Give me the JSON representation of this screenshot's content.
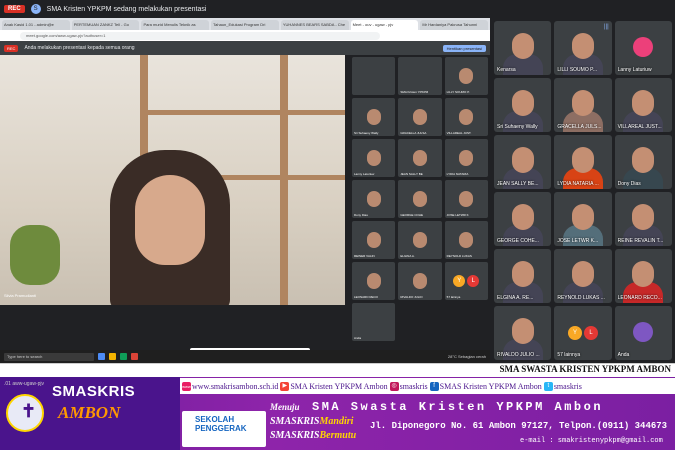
{
  "topbar": {
    "rec": "REC",
    "presenter_initial": "S",
    "status": "SMA Kristen YPKPM sedang melakukan presentasi"
  },
  "browser": {
    "tabs": [
      "Anak Kasid 1.01 - admin@e",
      "PERTEMUAN ZANKZ Tell - Go",
      "Para murid Menulis Teknik as",
      "Tahaun_Edukasi Program Dri",
      "YUHANNES BEARS SABDA - Che",
      "Meet - ouv - ugaw - pjv",
      "Mr Hardaniya Pakrusa Tahunni"
    ],
    "address": "meet.google.com/aww-ugaw-pjv?authuser=1",
    "meet_rec": "REC",
    "presenting_note": "Anda melakukan presentasi kepada semua orang",
    "stop_presenting": "Hentikan presentasi",
    "speaker_name": "Silvia Pramudianti",
    "share_note": "Meeting/google.co sedang dipresentasikan",
    "share_note_btn": "Stop sharing",
    "share_note_hide": "Hide",
    "meeting_code": "aww-ugaw-pjv",
    "taskbar_search": "Type here to search",
    "taskbar_time": "28°C  Sebagian cerah"
  },
  "mini_tiles": [
    "",
    "SMA Kristen YPKPM",
    "LILLY SOUMO P.",
    "Sri Suhaeny Wally",
    "GRACELLA JULSA",
    "VILLAREAL JUST.",
    "Lanny Laturiuw",
    "JEAN SALLY BE",
    "LYDIA NATARIA",
    "Dony Dias",
    "GEORGE COHE",
    "JOSE LETWR K",
    "REINER VALIN",
    "ELGINA A.",
    "REYNOLD LUKAS",
    "LEONARD RECO",
    "RIVALDO JULIO",
    "57 lainnya",
    "Anda"
  ],
  "mini_more": {
    "y": "Y",
    "l": "L"
  },
  "grid": [
    {
      "name": "Kenarsa",
      "type": "video"
    },
    {
      "name": "LILLI SOUMO P...",
      "type": "video",
      "mic": "|||"
    },
    {
      "name": "Lanny Laturiuw",
      "type": "avatar"
    },
    {
      "name": "Sri Suhaeny Wally",
      "type": "video"
    },
    {
      "name": "GRACELLA JULS...",
      "type": "video"
    },
    {
      "name": "VILLAREAL JUST...",
      "type": "video"
    },
    {
      "name": "JEAN SALLY BE...",
      "type": "video"
    },
    {
      "name": "LYDIA NATARIA ...",
      "type": "video"
    },
    {
      "name": "Dony Dias",
      "type": "video"
    },
    {
      "name": "GEORGE COHE...",
      "type": "video"
    },
    {
      "name": "JOSE LETWR K...",
      "type": "video"
    },
    {
      "name": "REINE REVALIN T...",
      "type": "video"
    },
    {
      "name": "ELGINA A. RE...",
      "type": "video"
    },
    {
      "name": "REYNOLD LUKAS ...",
      "type": "video"
    },
    {
      "name": "LEONARD RECO...",
      "type": "video"
    },
    {
      "name": "RIVALDO JULIO ...",
      "type": "video"
    },
    {
      "name": "57 lainnya",
      "type": "more"
    },
    {
      "name": "Anda",
      "type": "self"
    }
  ],
  "grid_more": {
    "y": "Y",
    "l": "L"
  },
  "banner": {
    "top_text": "SMA SWASTA KRISTEN YPKPM AMBON",
    "left_code": ".01  aww-ugaw-pjv",
    "brand_line1": "SMASKRIS",
    "brand_line2": "AMBON",
    "logo_glyph": "✝",
    "links": [
      {
        "icon": "www",
        "text": "www.smakrisambon.sch.id",
        "color": "#e91e63"
      },
      {
        "icon": "▶",
        "text": "SMA Kristen YPKPM Ambon",
        "color": "#f44336"
      },
      {
        "icon": "◎",
        "text": "smaskris",
        "color": "#c2185b"
      },
      {
        "icon": "f",
        "text": "SMAS Kristen YPKPM Ambon",
        "color": "#1565c0"
      },
      {
        "icon": "t",
        "text": "smaskris",
        "color": "#29b6f6"
      }
    ],
    "menuju": "Menuju",
    "school": "SMA Swasta Kristen YPKPM Ambon",
    "penggerak_1": "SEKOLAH",
    "penggerak_2": "PENGGERAK",
    "mandiri_1": "SMASKRIS",
    "mandiri_2": "Mandiri",
    "bermutu_1": "SMASKRIS",
    "bermutu_2": "Bermutu",
    "address": "Jl. Diponegoro  No. 61 Ambon 97127, Telpon.(0911) 344673",
    "email": "e-mail : smakristenypkpm@gmail.com"
  }
}
